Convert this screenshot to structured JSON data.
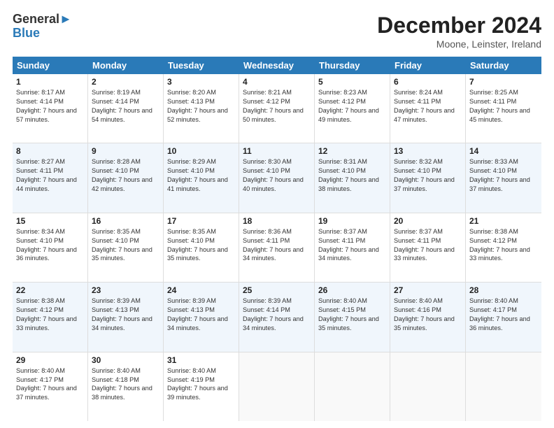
{
  "logo": {
    "line1": "General",
    "line2": "Blue"
  },
  "title": "December 2024",
  "location": "Moone, Leinster, Ireland",
  "days": [
    "Sunday",
    "Monday",
    "Tuesday",
    "Wednesday",
    "Thursday",
    "Friday",
    "Saturday"
  ],
  "weeks": [
    [
      {
        "day": "1",
        "sunrise": "8:17 AM",
        "sunset": "4:14 PM",
        "daylight": "7 hours and 57 minutes."
      },
      {
        "day": "2",
        "sunrise": "8:19 AM",
        "sunset": "4:14 PM",
        "daylight": "7 hours and 54 minutes."
      },
      {
        "day": "3",
        "sunrise": "8:20 AM",
        "sunset": "4:13 PM",
        "daylight": "7 hours and 52 minutes."
      },
      {
        "day": "4",
        "sunrise": "8:21 AM",
        "sunset": "4:12 PM",
        "daylight": "7 hours and 50 minutes."
      },
      {
        "day": "5",
        "sunrise": "8:23 AM",
        "sunset": "4:12 PM",
        "daylight": "7 hours and 49 minutes."
      },
      {
        "day": "6",
        "sunrise": "8:24 AM",
        "sunset": "4:11 PM",
        "daylight": "7 hours and 47 minutes."
      },
      {
        "day": "7",
        "sunrise": "8:25 AM",
        "sunset": "4:11 PM",
        "daylight": "7 hours and 45 minutes."
      }
    ],
    [
      {
        "day": "8",
        "sunrise": "8:27 AM",
        "sunset": "4:11 PM",
        "daylight": "7 hours and 44 minutes."
      },
      {
        "day": "9",
        "sunrise": "8:28 AM",
        "sunset": "4:10 PM",
        "daylight": "7 hours and 42 minutes."
      },
      {
        "day": "10",
        "sunrise": "8:29 AM",
        "sunset": "4:10 PM",
        "daylight": "7 hours and 41 minutes."
      },
      {
        "day": "11",
        "sunrise": "8:30 AM",
        "sunset": "4:10 PM",
        "daylight": "7 hours and 40 minutes."
      },
      {
        "day": "12",
        "sunrise": "8:31 AM",
        "sunset": "4:10 PM",
        "daylight": "7 hours and 38 minutes."
      },
      {
        "day": "13",
        "sunrise": "8:32 AM",
        "sunset": "4:10 PM",
        "daylight": "7 hours and 37 minutes."
      },
      {
        "day": "14",
        "sunrise": "8:33 AM",
        "sunset": "4:10 PM",
        "daylight": "7 hours and 37 minutes."
      }
    ],
    [
      {
        "day": "15",
        "sunrise": "8:34 AM",
        "sunset": "4:10 PM",
        "daylight": "7 hours and 36 minutes."
      },
      {
        "day": "16",
        "sunrise": "8:35 AM",
        "sunset": "4:10 PM",
        "daylight": "7 hours and 35 minutes."
      },
      {
        "day": "17",
        "sunrise": "8:35 AM",
        "sunset": "4:10 PM",
        "daylight": "7 hours and 35 minutes."
      },
      {
        "day": "18",
        "sunrise": "8:36 AM",
        "sunset": "4:11 PM",
        "daylight": "7 hours and 34 minutes."
      },
      {
        "day": "19",
        "sunrise": "8:37 AM",
        "sunset": "4:11 PM",
        "daylight": "7 hours and 34 minutes."
      },
      {
        "day": "20",
        "sunrise": "8:37 AM",
        "sunset": "4:11 PM",
        "daylight": "7 hours and 33 minutes."
      },
      {
        "day": "21",
        "sunrise": "8:38 AM",
        "sunset": "4:12 PM",
        "daylight": "7 hours and 33 minutes."
      }
    ],
    [
      {
        "day": "22",
        "sunrise": "8:38 AM",
        "sunset": "4:12 PM",
        "daylight": "7 hours and 33 minutes."
      },
      {
        "day": "23",
        "sunrise": "8:39 AM",
        "sunset": "4:13 PM",
        "daylight": "7 hours and 34 minutes."
      },
      {
        "day": "24",
        "sunrise": "8:39 AM",
        "sunset": "4:13 PM",
        "daylight": "7 hours and 34 minutes."
      },
      {
        "day": "25",
        "sunrise": "8:39 AM",
        "sunset": "4:14 PM",
        "daylight": "7 hours and 34 minutes."
      },
      {
        "day": "26",
        "sunrise": "8:40 AM",
        "sunset": "4:15 PM",
        "daylight": "7 hours and 35 minutes."
      },
      {
        "day": "27",
        "sunrise": "8:40 AM",
        "sunset": "4:16 PM",
        "daylight": "7 hours and 35 minutes."
      },
      {
        "day": "28",
        "sunrise": "8:40 AM",
        "sunset": "4:17 PM",
        "daylight": "7 hours and 36 minutes."
      }
    ],
    [
      {
        "day": "29",
        "sunrise": "8:40 AM",
        "sunset": "4:17 PM",
        "daylight": "7 hours and 37 minutes."
      },
      {
        "day": "30",
        "sunrise": "8:40 AM",
        "sunset": "4:18 PM",
        "daylight": "7 hours and 38 minutes."
      },
      {
        "day": "31",
        "sunrise": "8:40 AM",
        "sunset": "4:19 PM",
        "daylight": "7 hours and 39 minutes."
      },
      {
        "day": "",
        "sunrise": "",
        "sunset": "",
        "daylight": ""
      },
      {
        "day": "",
        "sunrise": "",
        "sunset": "",
        "daylight": ""
      },
      {
        "day": "",
        "sunrise": "",
        "sunset": "",
        "daylight": ""
      },
      {
        "day": "",
        "sunrise": "",
        "sunset": "",
        "daylight": ""
      }
    ]
  ]
}
